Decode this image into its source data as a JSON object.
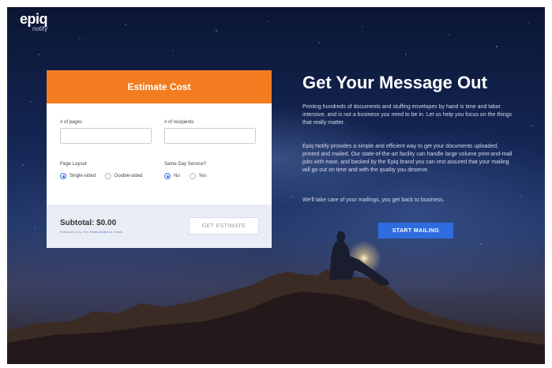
{
  "brand": {
    "logo_main": "epiq",
    "logo_sub": "notify"
  },
  "estimator": {
    "title": "Estimate Cost",
    "pages_label": "# of pages",
    "pages_value": "",
    "recipients_label": "# of recipients",
    "recipients_value": "",
    "layout_label": "Page Layout",
    "layout_options": [
      "Single-sided",
      "Double-sided"
    ],
    "layout_selected": "Single-sided",
    "sameday_label": "Same Day Service?",
    "sameday_options": [
      "No",
      "Yes"
    ],
    "sameday_selected": "No",
    "subtotal": "Subtotal: $0.00",
    "note_prefix": "Estimation only. See ",
    "note_link": "Terms of Use",
    "note_suffix": " for details.",
    "button": "GET ESTIMATE"
  },
  "hero": {
    "title": "Get Your Message Out",
    "p1": "Printing hundreds of documents and stuffing envelopes by hand is time and labor intensive, and is not a business you need to be in. Let us help you focus on the things that really matter.",
    "p2": "Epiq Notify provides a simple and efficient way to get your documents uploaded, printed and mailed. Our state-of-the-art facility can handle large volume print-and-mail jobs with ease, and backed by the Epiq brand you can rest assured that your mailing will go out on time and with the quality you deserve.",
    "p3": "We'll take care of your mailings, you get back to business.",
    "cta": "START MAILING"
  },
  "colors": {
    "accent_orange": "#f47c20",
    "accent_blue": "#2f6ce0",
    "footer_bg": "#e9eef6"
  }
}
